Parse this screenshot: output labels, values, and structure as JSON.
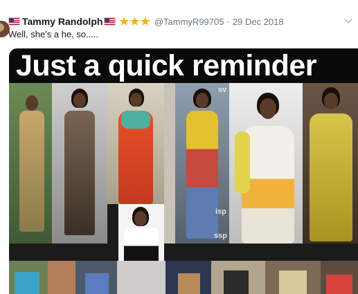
{
  "tweet": {
    "author_name": "Tammy Randolph",
    "stars": "★★★",
    "handle": "@TammyR99705",
    "separator": "·",
    "date": "29 Dec 2018",
    "text": "Well, she's a he, so.....",
    "more_icon": "chevron-down-icon",
    "flag_icon": "us-flag-icon"
  },
  "media": {
    "headline": "Just a quick reminder",
    "watermark_1": "sv",
    "watermark_2": "isp",
    "watermark_3": "ssp"
  },
  "colors": {
    "stars": "#f2b01e",
    "meta": "#657786",
    "headline_bg": "#0a0a0a"
  }
}
